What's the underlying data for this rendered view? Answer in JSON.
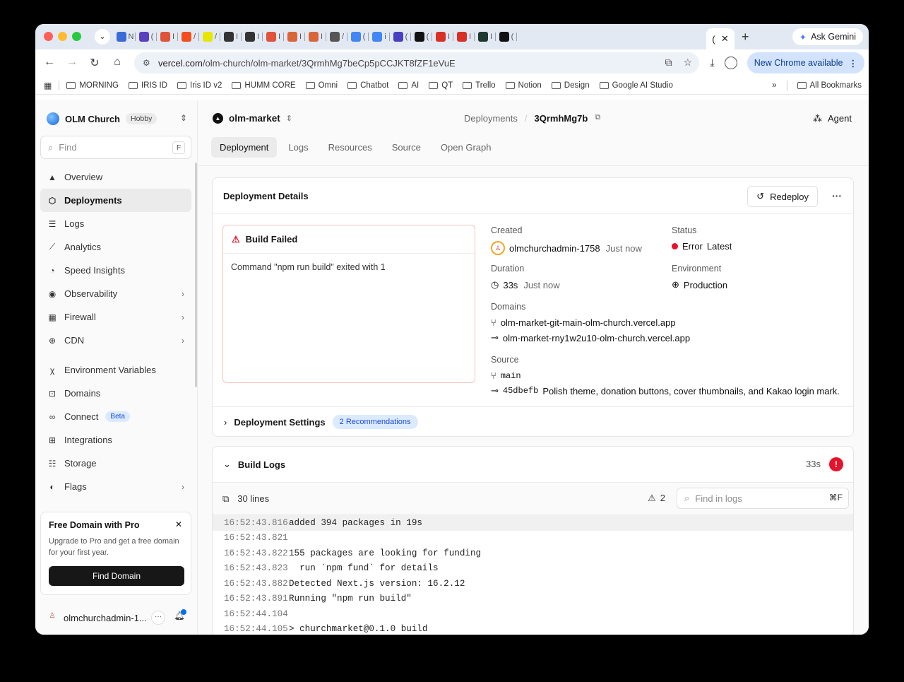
{
  "browser": {
    "tabs": [
      {
        "icon": "tab-favicon",
        "color": "#3b6bd6",
        "label": "N"
      },
      {
        "icon": "tab-favicon",
        "color": "#5a3fc0",
        "label": "("
      },
      {
        "icon": "tab-favicon",
        "color": "#e0523a",
        "label": "I"
      },
      {
        "icon": "tab-favicon",
        "color": "#f24e1e",
        "label": "/"
      },
      {
        "icon": "tab-favicon",
        "color": "#e6e600",
        "label": "/"
      },
      {
        "icon": "tab-favicon",
        "color": "#333333",
        "label": "I"
      },
      {
        "icon": "tab-favicon",
        "color": "#333333",
        "label": "I"
      },
      {
        "icon": "tab-favicon",
        "color": "#e0523a",
        "label": "I"
      },
      {
        "icon": "tab-favicon",
        "color": "#d9653b",
        "label": "I"
      },
      {
        "icon": "tab-favicon",
        "color": "#d9653b",
        "label": "I"
      },
      {
        "icon": "tab-favicon",
        "color": "#555555",
        "label": "/"
      },
      {
        "icon": "tab-favicon",
        "color": "#4285f4",
        "label": "("
      },
      {
        "icon": "tab-favicon",
        "color": "#4285f4",
        "label": "i"
      },
      {
        "icon": "tab-favicon",
        "color": "#4a3fc0",
        "label": "("
      },
      {
        "icon": "tab-favicon",
        "color": "#111111",
        "label": "("
      },
      {
        "icon": "tab-favicon",
        "color": "#d93025",
        "label": "I"
      },
      {
        "icon": "tab-favicon",
        "color": "#d93025",
        "label": "I"
      },
      {
        "icon": "tab-favicon",
        "color": "#1e3a2f",
        "label": "I"
      },
      {
        "icon": "tab-favicon",
        "color": "#111111",
        "label": "("
      }
    ],
    "active_tab_label": "(",
    "ask_gemini": "Ask Gemini",
    "url_host": "vercel.com",
    "url_path": "/olm-church/olm-market/3QrmhMg7beCp5pCCJKT8fZF1eVuE",
    "new_chrome": "New Chrome available",
    "bookmarks": [
      "MORNING",
      "IRIS ID",
      "Iris ID v2",
      "HUMM CORE",
      "Omni",
      "Chatbot",
      "AI",
      "QT",
      "Trello",
      "Notion",
      "Design",
      "Google AI Studio"
    ],
    "all_bookmarks": "All Bookmarks",
    "more_bookmarks": "»"
  },
  "sidebar": {
    "team": "OLM Church",
    "plan": "Hobby",
    "find_placeholder": "Find",
    "find_key": "F",
    "items": [
      {
        "label": "Overview",
        "icon": "vercel-triangle-icon"
      },
      {
        "label": "Deployments",
        "icon": "cube-icon"
      },
      {
        "label": "Logs",
        "icon": "list-icon"
      },
      {
        "label": "Analytics",
        "icon": "chart-icon"
      },
      {
        "label": "Speed Insights",
        "icon": "gauge-icon"
      },
      {
        "label": "Observability",
        "icon": "eye-icon"
      },
      {
        "label": "Firewall",
        "icon": "firewall-icon"
      },
      {
        "label": "CDN",
        "icon": "globe-icon"
      },
      {
        "label": "Environment Variables",
        "icon": "variable-icon"
      },
      {
        "label": "Domains",
        "icon": "domain-icon"
      },
      {
        "label": "Connect",
        "icon": "connect-icon",
        "badge": "Beta"
      },
      {
        "label": "Integrations",
        "icon": "integrations-icon"
      },
      {
        "label": "Storage",
        "icon": "database-icon"
      },
      {
        "label": "Flags",
        "icon": "toggle-icon"
      }
    ],
    "promo": {
      "title": "Free Domain with Pro",
      "text": "Upgrade to Pro and get a free domain for your first year.",
      "button": "Find Domain"
    },
    "user": "olmchurchadmin-1..."
  },
  "header": {
    "project": "olm-market",
    "crumb_parent": "Deployments",
    "crumb_current": "3QrmhMg7b",
    "agent": "Agent"
  },
  "subtabs": [
    "Deployment",
    "Logs",
    "Resources",
    "Source",
    "Open Graph"
  ],
  "details": {
    "title": "Deployment Details",
    "redeploy": "Redeploy",
    "build_failed": "Build Failed",
    "error_message": "Command \"npm run build\" exited with 1",
    "created_label": "Created",
    "created_user": "olmchurchadmin-1758",
    "created_time": "Just now",
    "status_label": "Status",
    "status_value": "Error",
    "status_tag": "Latest",
    "status_color": "#e5132b",
    "duration_label": "Duration",
    "duration_value": "33s",
    "duration_time": "Just now",
    "environment_label": "Environment",
    "environment_value": "Production",
    "domains_label": "Domains",
    "domains": [
      "olm-market-git-main-olm-church.vercel.app",
      "olm-market-rny1w2u10-olm-church.vercel.app"
    ],
    "source_label": "Source",
    "branch": "main",
    "commit_sha": "45dbefb",
    "commit_message": "Polish theme, donation buttons, cover thumbnails, and Kakao login mark.",
    "settings_label": "Deployment Settings",
    "recommendations": "2 Recommendations"
  },
  "build_logs": {
    "title": "Build Logs",
    "duration": "33s",
    "line_count": "30 lines",
    "warnings": "2",
    "search_placeholder": "Find in logs",
    "search_key": "⌘F",
    "lines": [
      {
        "t": "16:52:43.816",
        "m": "added 394 packages in 19s"
      },
      {
        "t": "16:52:43.821",
        "m": ""
      },
      {
        "t": "16:52:43.822",
        "m": "155 packages are looking for funding"
      },
      {
        "t": "16:52:43.823",
        "m": "  run `npm fund` for details"
      },
      {
        "t": "16:52:43.882",
        "m": "Detected Next.js version: 16.2.12"
      },
      {
        "t": "16:52:43.891",
        "m": "Running \"npm run build\""
      },
      {
        "t": "16:52:44.104",
        "m": ""
      },
      {
        "t": "16:52:44.105",
        "m": "> churchmarket@0.1.0 build"
      }
    ]
  }
}
